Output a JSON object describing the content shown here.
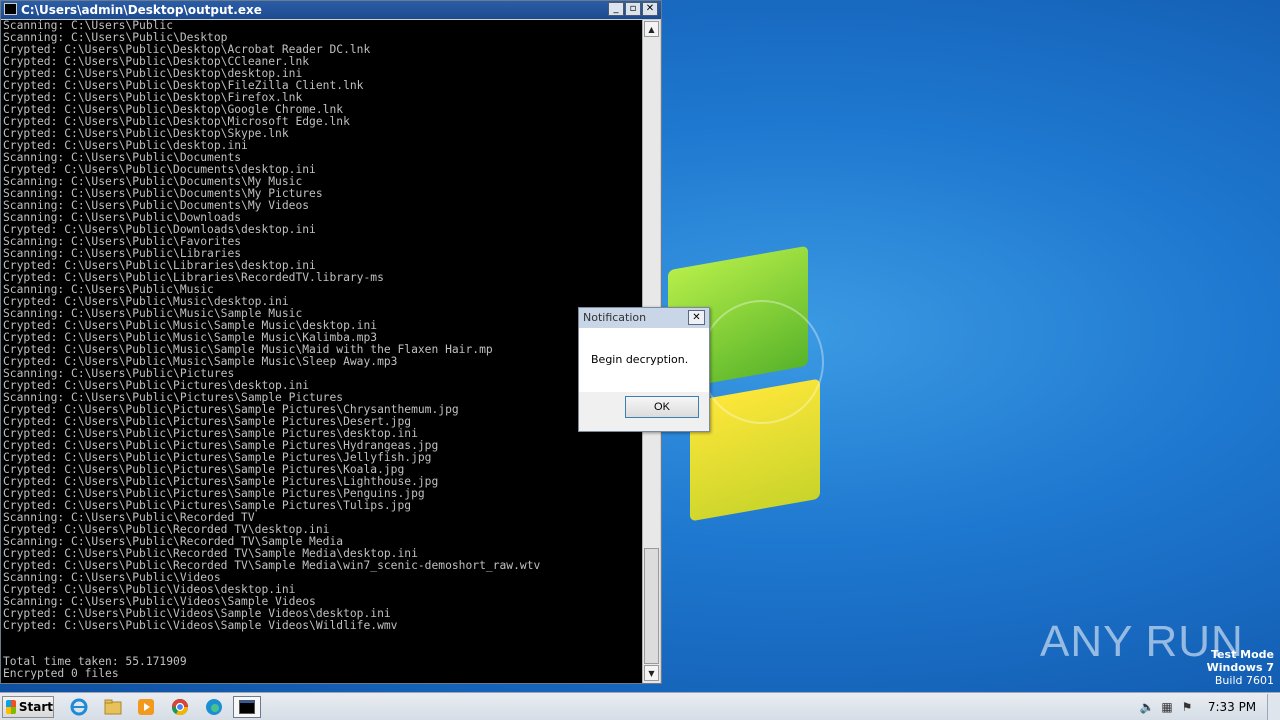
{
  "console": {
    "title": "C:\\Users\\admin\\Desktop\\output.exe",
    "lines": [
      "Scanning: C:\\Users\\Public",
      "Scanning: C:\\Users\\Public\\Desktop",
      "Crypted: C:\\Users\\Public\\Desktop\\Acrobat Reader DC.lnk",
      "Crypted: C:\\Users\\Public\\Desktop\\CCleaner.lnk",
      "Crypted: C:\\Users\\Public\\Desktop\\desktop.ini",
      "Crypted: C:\\Users\\Public\\Desktop\\FileZilla Client.lnk",
      "Crypted: C:\\Users\\Public\\Desktop\\Firefox.lnk",
      "Crypted: C:\\Users\\Public\\Desktop\\Google Chrome.lnk",
      "Crypted: C:\\Users\\Public\\Desktop\\Microsoft Edge.lnk",
      "Crypted: C:\\Users\\Public\\Desktop\\Skype.lnk",
      "Crypted: C:\\Users\\Public\\desktop.ini",
      "Scanning: C:\\Users\\Public\\Documents",
      "Crypted: C:\\Users\\Public\\Documents\\desktop.ini",
      "Scanning: C:\\Users\\Public\\Documents\\My Music",
      "Scanning: C:\\Users\\Public\\Documents\\My Pictures",
      "Scanning: C:\\Users\\Public\\Documents\\My Videos",
      "Scanning: C:\\Users\\Public\\Downloads",
      "Crypted: C:\\Users\\Public\\Downloads\\desktop.ini",
      "Scanning: C:\\Users\\Public\\Favorites",
      "Scanning: C:\\Users\\Public\\Libraries",
      "Crypted: C:\\Users\\Public\\Libraries\\desktop.ini",
      "Crypted: C:\\Users\\Public\\Libraries\\RecordedTV.library-ms",
      "Scanning: C:\\Users\\Public\\Music",
      "Crypted: C:\\Users\\Public\\Music\\desktop.ini",
      "Scanning: C:\\Users\\Public\\Music\\Sample Music",
      "Crypted: C:\\Users\\Public\\Music\\Sample Music\\desktop.ini",
      "Crypted: C:\\Users\\Public\\Music\\Sample Music\\Kalimba.mp3",
      "Crypted: C:\\Users\\Public\\Music\\Sample Music\\Maid with the Flaxen Hair.mp",
      "Crypted: C:\\Users\\Public\\Music\\Sample Music\\Sleep Away.mp3",
      "Scanning: C:\\Users\\Public\\Pictures",
      "Crypted: C:\\Users\\Public\\Pictures\\desktop.ini",
      "Scanning: C:\\Users\\Public\\Pictures\\Sample Pictures",
      "Crypted: C:\\Users\\Public\\Pictures\\Sample Pictures\\Chrysanthemum.jpg",
      "Crypted: C:\\Users\\Public\\Pictures\\Sample Pictures\\Desert.jpg",
      "Crypted: C:\\Users\\Public\\Pictures\\Sample Pictures\\desktop.ini",
      "Crypted: C:\\Users\\Public\\Pictures\\Sample Pictures\\Hydrangeas.jpg",
      "Crypted: C:\\Users\\Public\\Pictures\\Sample Pictures\\Jellyfish.jpg",
      "Crypted: C:\\Users\\Public\\Pictures\\Sample Pictures\\Koala.jpg",
      "Crypted: C:\\Users\\Public\\Pictures\\Sample Pictures\\Lighthouse.jpg",
      "Crypted: C:\\Users\\Public\\Pictures\\Sample Pictures\\Penguins.jpg",
      "Crypted: C:\\Users\\Public\\Pictures\\Sample Pictures\\Tulips.jpg",
      "Scanning: C:\\Users\\Public\\Recorded TV",
      "Crypted: C:\\Users\\Public\\Recorded TV\\desktop.ini",
      "Scanning: C:\\Users\\Public\\Recorded TV\\Sample Media",
      "Crypted: C:\\Users\\Public\\Recorded TV\\Sample Media\\desktop.ini",
      "Crypted: C:\\Users\\Public\\Recorded TV\\Sample Media\\win7_scenic-demoshort_raw.wtv",
      "Scanning: C:\\Users\\Public\\Videos",
      "Crypted: C:\\Users\\Public\\Videos\\desktop.ini",
      "Scanning: C:\\Users\\Public\\Videos\\Sample Videos",
      "Crypted: C:\\Users\\Public\\Videos\\Sample Videos\\desktop.ini",
      "Crypted: C:\\Users\\Public\\Videos\\Sample Videos\\Wildlife.wmv",
      "",
      "",
      "Total time taken: 55.171909",
      "Encrypted 0 files"
    ]
  },
  "dialog": {
    "title": "Notification",
    "message": "Begin decryption.",
    "ok_label": "OK",
    "close_glyph": "✕"
  },
  "watermark": {
    "left": "ANY",
    "right": "RUN"
  },
  "version": {
    "line1": "Test Mode",
    "line2": "Windows 7",
    "line3": "Build 7601"
  },
  "taskbar": {
    "start_label": "Start",
    "clock": "7:33 PM",
    "icons": [
      "internet-explorer-icon",
      "folder-icon",
      "media-player-icon",
      "chrome-icon",
      "edge-icon",
      "console-window-icon"
    ]
  },
  "colors": {
    "console_bg": "#000000",
    "console_text": "#c0c0c0",
    "titlebar": "#2b5ea8",
    "desktop": "#1f79d0"
  }
}
